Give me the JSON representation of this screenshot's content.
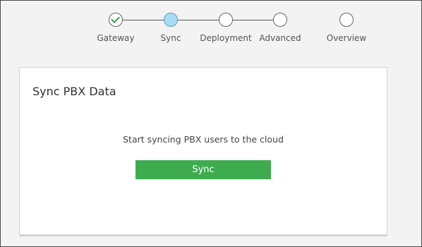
{
  "wizard": {
    "steps": [
      {
        "label": "Gateway",
        "state": "completed"
      },
      {
        "label": "Sync",
        "state": "active"
      },
      {
        "label": "Deployment",
        "state": "pending"
      },
      {
        "label": "Advanced",
        "state": "pending"
      },
      {
        "label": "Overview",
        "state": "pending"
      }
    ]
  },
  "card": {
    "title": "Sync PBX Data",
    "message": "Start syncing PBX users to the cloud",
    "button_label": "Sync"
  },
  "colors": {
    "active_step": "#a9dbf3",
    "completed_check": "#3c9c46",
    "primary_button": "#3fab4f"
  }
}
